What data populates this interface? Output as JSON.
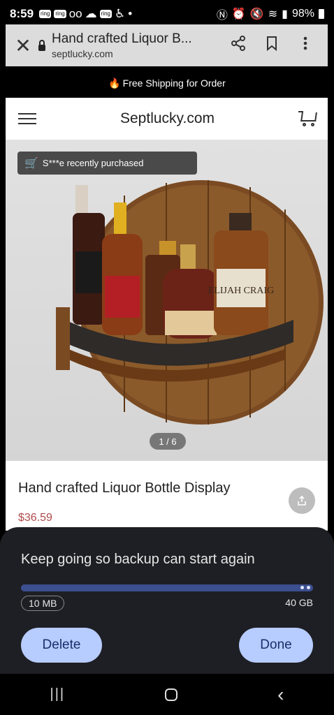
{
  "status_bar": {
    "time": "8:59",
    "badges": [
      "ring",
      "ring",
      "ring"
    ],
    "battery": "98%"
  },
  "browser": {
    "page_title": "Hand crafted Liquor B...",
    "domain": "septlucky.com",
    "close_icon": "close-icon",
    "share_icon": "share-icon",
    "bookmark_icon": "bookmark-icon",
    "menu_icon": "more-vert-icon"
  },
  "promo": {
    "text": "Free Shipping for Order"
  },
  "site": {
    "name": "Septlucky.com"
  },
  "product": {
    "toast": "S***e   recently purchased",
    "image_counter": "1 / 6",
    "image_label": "ELIJAH CRAIG",
    "title": "Hand crafted Liquor Bottle Display",
    "price": "$36.59"
  },
  "backup_sheet": {
    "message": "Keep going so backup can start again",
    "progress_fraction": 1.0,
    "size_left": "10 MB",
    "size_right": "40 GB",
    "delete_label": "Delete",
    "done_label": "Done",
    "accent_color": "#3c4f8f",
    "button_color": "#b7ccff"
  }
}
